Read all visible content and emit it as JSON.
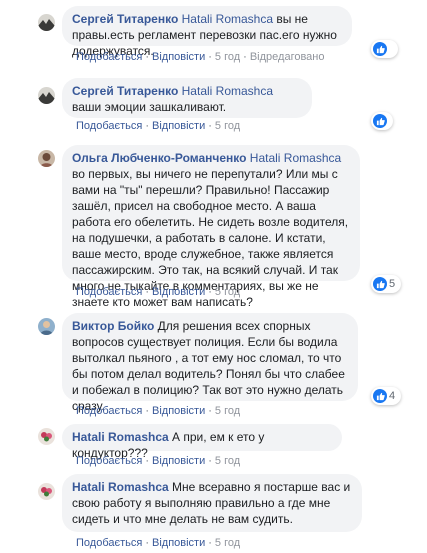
{
  "actions": {
    "like": "Подобається",
    "reply": "Відповісти",
    "separator": "·"
  },
  "colors": {
    "author": "#385898",
    "bubble": "#f2f3f5",
    "like": "#1877f2",
    "meta": "#606770"
  },
  "comments": [
    {
      "author": "Сергей Титаренко",
      "mention": "Hatali Romashca",
      "text": " вы не правы.есть регламент перевозки пас.его нужно додержуватся.",
      "time": "5 год",
      "edited": "Відредаговано",
      "reaction_icon": "like-icon",
      "reaction_count": "",
      "avatar": "landscape-avatar-icon"
    },
    {
      "author": "Сергей Титаренко",
      "mention": "Hatali Romashca",
      "text": " ваши эмоции зашкаливают.",
      "time": "5 год",
      "reaction_icon": "like-icon",
      "reaction_count": "",
      "avatar": "landscape-avatar-icon"
    },
    {
      "author": "Ольга Любченко-Романченко",
      "mention": "Hatali Romashca",
      "text": " во первых, вы ничего не перепутали? Или мы с вами на \"ты\" перешли? Правильно! Пассажир зашёл, присел на свободное место. А ваша работа его обелетить. Не сидеть возле водителя, на подушечки, а работать в салоне. И кстати, ваше место, вроде служебное, также является пассажирским. Это так, на всякий случай. И так много не тыкайте в комментариях, вы же не знаете кто может вам написать?",
      "time": "5 год",
      "reaction_icon": "like-icon",
      "reaction_count": "5",
      "avatar": "woman-avatar-icon"
    },
    {
      "author": "Виктор Бойко",
      "mention": "",
      "text": " Для решения всех спорных вопросов существует полиция. Если бы водила вытолкал пьяного , а тот ему нос сломал, то что бы потом делал водитель? Понял бы что слабее и побежал в полицию? Так вот это нужно делать сразу.",
      "time": "5 год",
      "reaction_icon": "like-icon",
      "reaction_count": "4",
      "avatar": "man-avatar-icon"
    },
    {
      "author": "Hatali Romashca",
      "mention": "",
      "text": " А при, ем к ето у кондуктор???",
      "time": "5 год",
      "avatar": "flower-avatar-icon"
    },
    {
      "author": "Hatali Romashca",
      "mention": "",
      "text": " Мне всеравно я постарше вас и свою работу я выполняю правильно а где мне сидеть и что мне делать не вам судить.",
      "time": "5 год",
      "avatar": "flower-avatar-icon"
    }
  ]
}
